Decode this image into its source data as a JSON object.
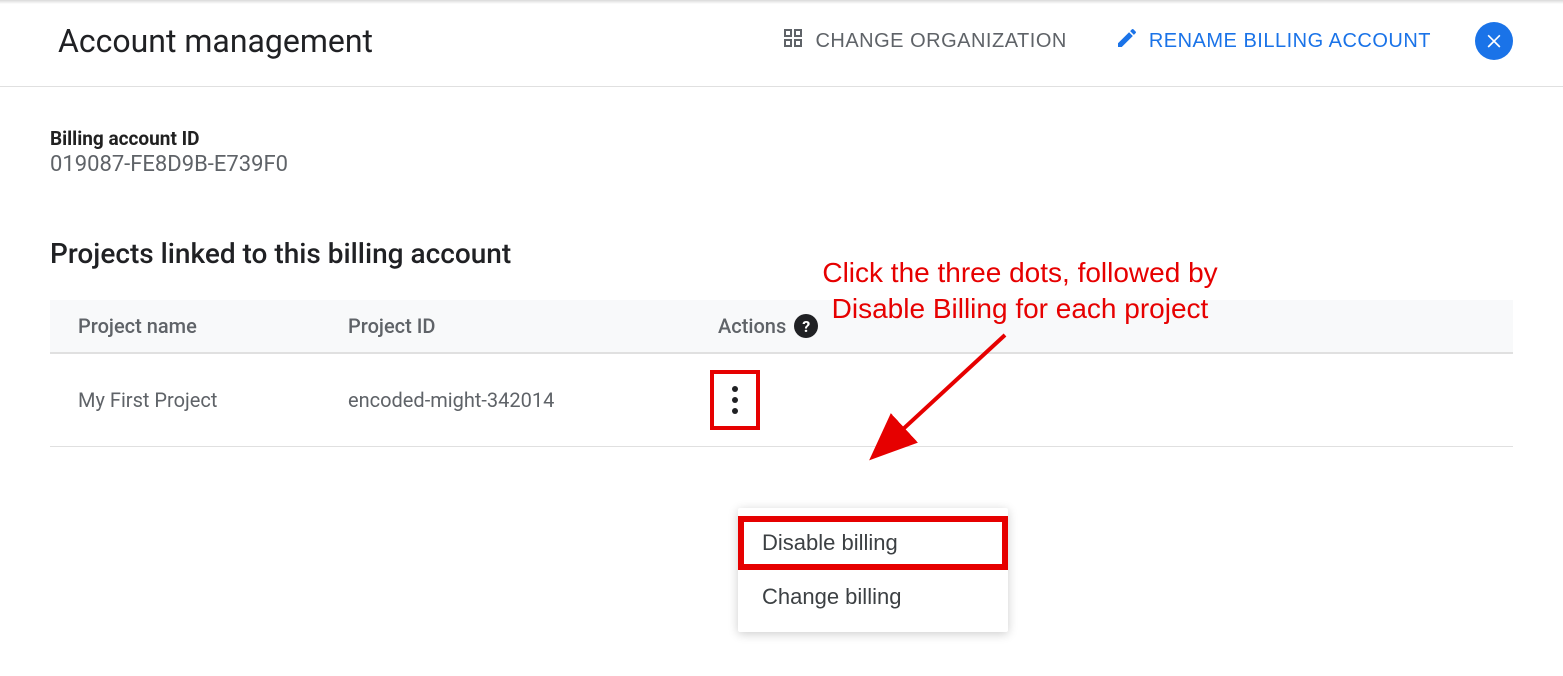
{
  "header": {
    "title": "Account management",
    "change_org_label": "CHANGE ORGANIZATION",
    "rename_label": "RENAME BILLING ACCOUNT"
  },
  "billing": {
    "id_label": "Billing account ID",
    "id_value": "019087-FE8D9B-E739F0"
  },
  "section": {
    "title": "Projects linked to this billing account"
  },
  "table": {
    "headers": {
      "name": "Project name",
      "id": "Project ID",
      "actions": "Actions"
    },
    "rows": [
      {
        "name": "My First Project",
        "id": "encoded-might-342014"
      }
    ]
  },
  "menu": {
    "disable": "Disable billing",
    "change": "Change billing"
  },
  "annotation": {
    "line1": "Click the three dots, followed by",
    "line2": "Disable Billing for each project"
  }
}
